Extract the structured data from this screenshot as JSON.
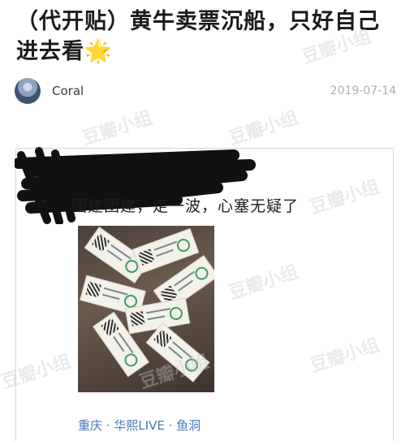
{
  "post": {
    "title": "（代开贴）黄牛卖票沉船，只好自己进去看",
    "title_emoji": "🌟",
    "author": "Coral",
    "date": "2019-07-14"
  },
  "card": {
    "text": "团建团建，走一波，心塞无疑了",
    "location": "重庆 · 华熙LIVE · 鱼洞"
  },
  "watermark": "豆瓣小组",
  "colors": {
    "location_link": "#4a78b8",
    "date": "#b0b0b0"
  }
}
